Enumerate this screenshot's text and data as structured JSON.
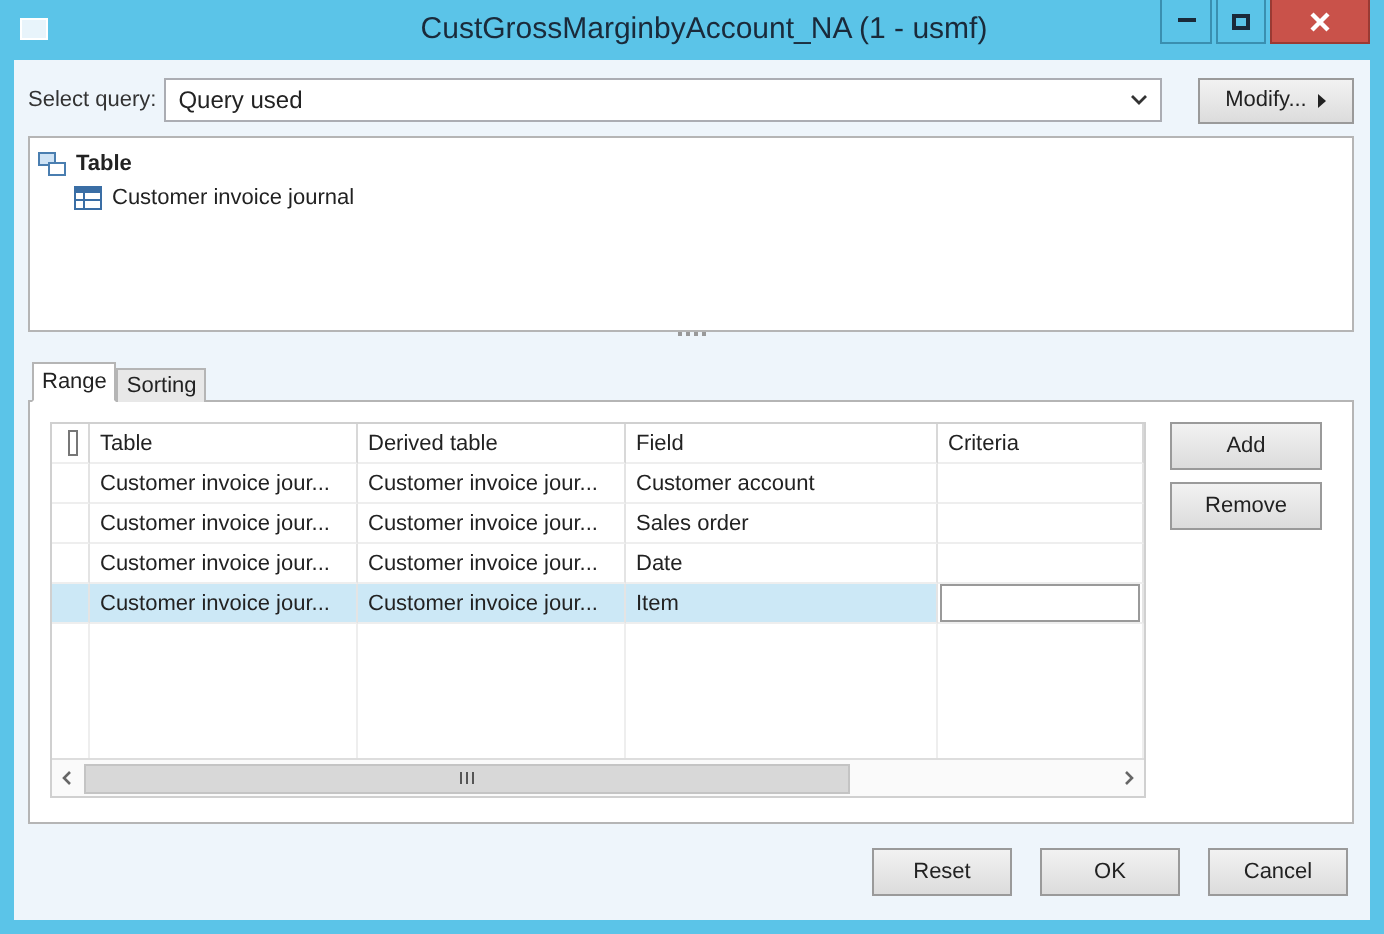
{
  "window": {
    "title": "CustGrossMarginbyAccount_NA (1 - usmf)"
  },
  "query": {
    "label": "Select query:",
    "value": "Query used",
    "modify_button": "Modify..."
  },
  "tree": [
    {
      "label": "Table",
      "children": [
        {
          "label": "Customer invoice journal"
        }
      ]
    }
  ],
  "tabs": [
    {
      "label": "Range",
      "selected": true
    },
    {
      "label": "Sorting",
      "selected": false
    }
  ],
  "table": {
    "select_all": {
      "checked": false
    },
    "columns": [
      "Table",
      "Derived table",
      "Field",
      "Criteria"
    ],
    "rows": [
      {
        "table": "Customer invoice jour...",
        "derived_table": "Customer invoice jour...",
        "field": "Customer account",
        "selected": false
      },
      {
        "table": "Customer invoice jour...",
        "derived_table": "Customer invoice jour...",
        "field": "Sales order",
        "selected": false
      },
      {
        "table": "Customer invoice jour...",
        "derived_table": "Customer invoice jour...",
        "field": "Date",
        "selected": false
      },
      {
        "table": "Customer invoice jour...",
        "derived_table": "Customer invoice jour...",
        "field": "Item",
        "selected": true
      }
    ]
  },
  "side_buttons": [
    "Add",
    "Remove"
  ],
  "footer_buttons": [
    "Reset",
    "OK",
    "Cancel"
  ]
}
